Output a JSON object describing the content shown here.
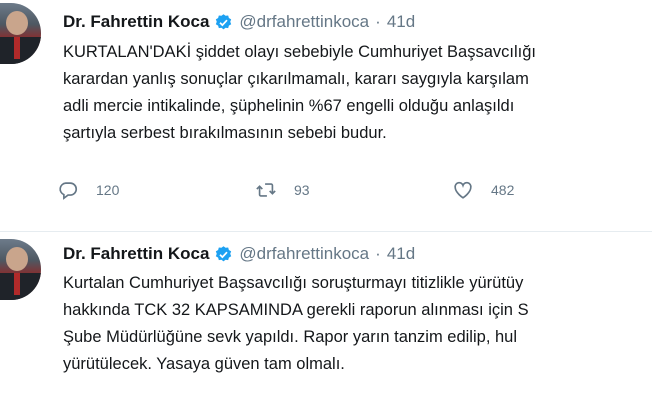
{
  "tweets": [
    {
      "author_name": "Dr. Fahrettin Koca",
      "handle": "@drfahrettinkoca",
      "separator": "·",
      "time": "41d",
      "lines": [
        "KURTALAN'DAKİ şiddet olayı sebebiyle Cumhuriyet Başsavcılığı",
        "karardan yanlış sonuçlar çıkarılmamalı, kararı saygıyla karşılam",
        "adli mercie intikalinde, şüphelinin %67 engelli olduğu anlaşıldı",
        "şartıyla serbest bırakılmasının sebebi budur."
      ],
      "replies": "120",
      "retweets": "93",
      "likes": "482"
    },
    {
      "author_name": "Dr. Fahrettin Koca",
      "handle": "@drfahrettinkoca",
      "separator": "·",
      "time": "41d",
      "lines": [
        "Kurtalan Cumhuriyet Başsavcılığı soruşturmayı titizlikle yürütüy",
        "hakkında TCK 32 KAPSAMINDA gerekli raporun alınması için S",
        "Şube Müdürlüğüne sevk yapıldı. Rapor yarın tanzim edilip, hul",
        "yürütülecek. Yasaya güven tam olmalı."
      ]
    }
  ],
  "colors": {
    "verified": "#1da1f2",
    "muted": "#657786"
  },
  "icons": [
    "reply-icon",
    "retweet-icon",
    "like-icon",
    "verified-badge-icon"
  ]
}
